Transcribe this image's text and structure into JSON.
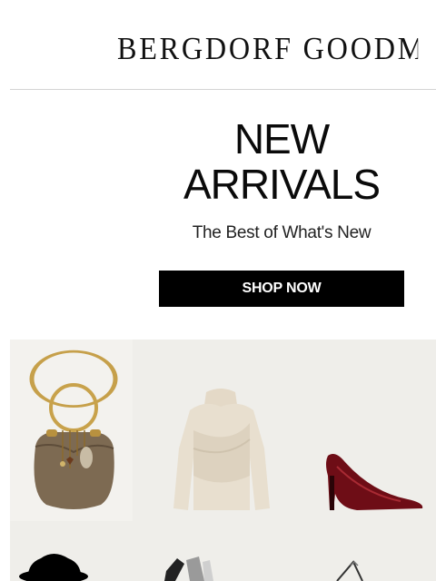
{
  "header": {
    "brand": "BERGDORF GOODMAN"
  },
  "hero": {
    "headline_line1": "NEW",
    "headline_line2": "ARRIVALS",
    "subheadline": "The Best of What's New",
    "cta_label": "SHOP NOW"
  },
  "products": [
    {
      "name": "handbag",
      "icon": "handbag-icon"
    },
    {
      "name": "sweater",
      "icon": "sweater-icon"
    },
    {
      "name": "heel",
      "icon": "pump-heel-icon"
    },
    {
      "name": "hat",
      "icon": "hat-icon"
    },
    {
      "name": "boots",
      "icon": "boots-icon"
    },
    {
      "name": "bag-strap",
      "icon": "strap-bag-icon"
    }
  ],
  "colors": {
    "cta_bg": "#000000",
    "cta_text": "#ffffff",
    "grid_bg": "#efeeea",
    "heel": "#6e0d16",
    "bag": "#7a6650",
    "sweater": "#e6dccb"
  }
}
